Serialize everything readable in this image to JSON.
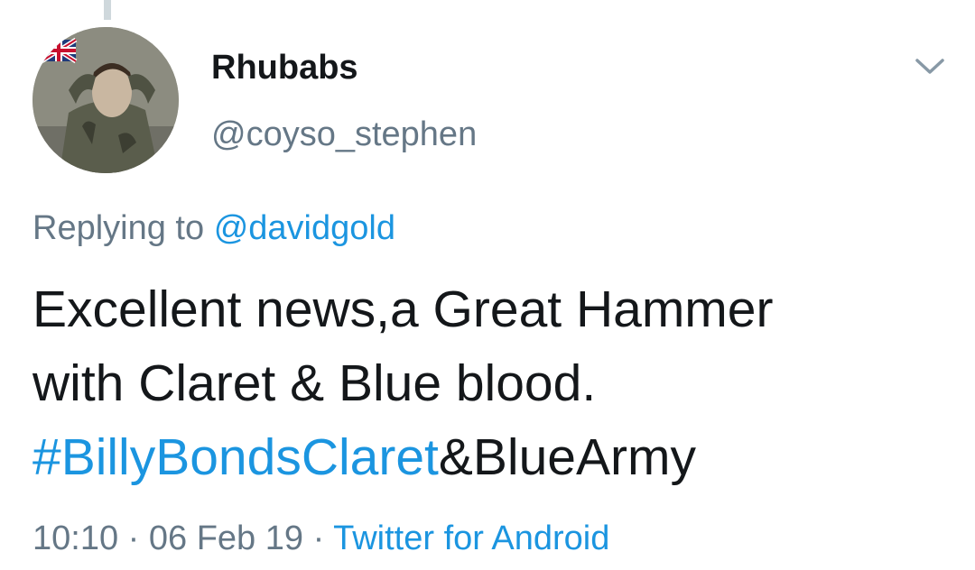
{
  "tweet": {
    "author": {
      "display_name": "Rhubabs",
      "handle": "@coyso_stephen"
    },
    "reply": {
      "prefix": "Replying to",
      "mention": "@davidgold"
    },
    "text": {
      "line1": "Excellent news,a Great Hammer",
      "line2": "with Claret & Blue blood.",
      "hashtag": "#BillyBondsClaret",
      "after_hashtag": "&BlueArmy"
    },
    "meta": {
      "time": "10:10",
      "separator": "·",
      "date": "06 Feb 19",
      "client": "Twitter for Android"
    }
  },
  "colors": {
    "text": "#14171a",
    "secondary": "#657786",
    "link": "#1b95e0"
  },
  "icons": {
    "menu": "chevron-down-icon",
    "avatar_flag": "union-jack-icon"
  }
}
